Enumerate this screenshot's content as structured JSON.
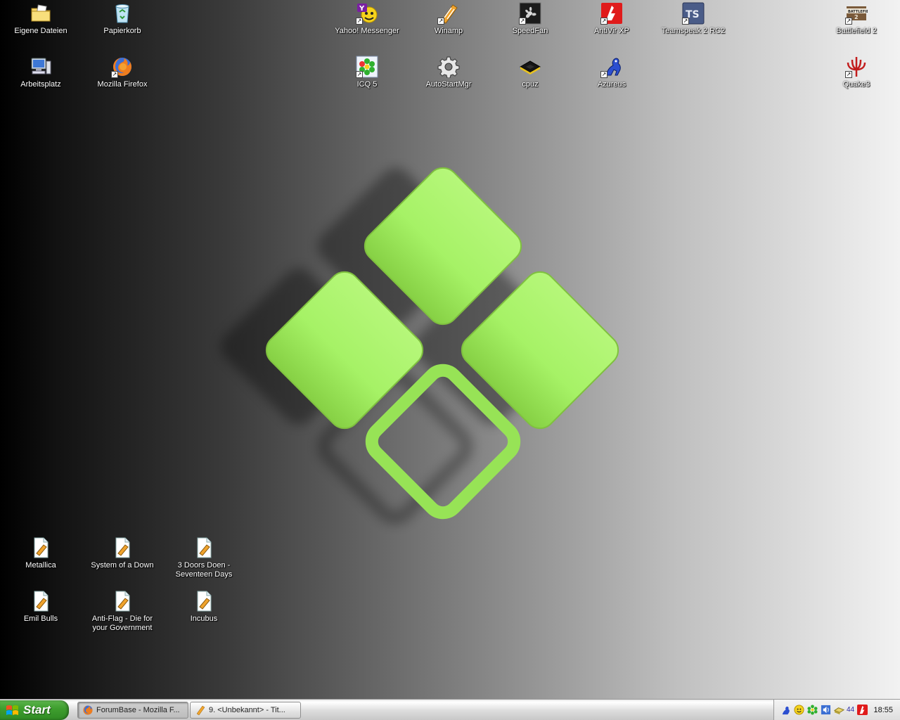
{
  "desktop": {
    "icons": [
      {
        "label": "Eigene Dateien",
        "icon": "folder-documents-icon"
      },
      {
        "label": "Papierkorb",
        "icon": "recycle-bin-icon"
      },
      {
        "label": "Arbeitsplatz",
        "icon": "my-computer-icon"
      },
      {
        "label": "Mozilla Firefox",
        "icon": "firefox-icon"
      },
      {
        "label": "Yahoo! Messenger",
        "icon": "yahoo-messenger-icon"
      },
      {
        "label": "Winamp",
        "icon": "winamp-icon"
      },
      {
        "label": "SpeedFan",
        "icon": "speedfan-icon"
      },
      {
        "label": "AntiVir XP",
        "icon": "antivir-icon"
      },
      {
        "label": "Teamspeak 2 RC2",
        "icon": "teamspeak-icon"
      },
      {
        "label": "ICQ 5",
        "icon": "icq-icon"
      },
      {
        "label": "AutoStartMgr",
        "icon": "gear-icon"
      },
      {
        "label": "cpuz",
        "icon": "chip-icon"
      },
      {
        "label": "Azureus",
        "icon": "azureus-frog-icon"
      },
      {
        "label": "Battlefield 2",
        "icon": "battlefield-icon"
      },
      {
        "label": "Quake3",
        "icon": "quake-icon"
      },
      {
        "label": "Metallica",
        "icon": "playlist-file-icon"
      },
      {
        "label": "System of a Down",
        "icon": "playlist-file-icon"
      },
      {
        "label": "3 Doors Doen - Seventeen Days",
        "icon": "playlist-file-icon"
      },
      {
        "label": "Emil Bulls",
        "icon": "playlist-file-icon"
      },
      {
        "label": "Anti-Flag - Die for your Government",
        "icon": "playlist-file-icon"
      },
      {
        "label": "Incubus",
        "icon": "playlist-file-icon"
      }
    ],
    "shortcut_arrow": "↗"
  },
  "taskbar": {
    "start_label": "Start",
    "tasks": [
      {
        "label": "ForumBase - Mozilla F...",
        "icon": "firefox-icon"
      },
      {
        "label": "9. <Unbekannt> - Tit...",
        "icon": "winamp-icon"
      }
    ],
    "tray": {
      "badge": "44",
      "clock": "18:55"
    }
  },
  "colors": {
    "wallpaper_green": "#a6f266",
    "start_green": "#3f9f2f",
    "taskbar_silver": "#d8d8d8"
  }
}
